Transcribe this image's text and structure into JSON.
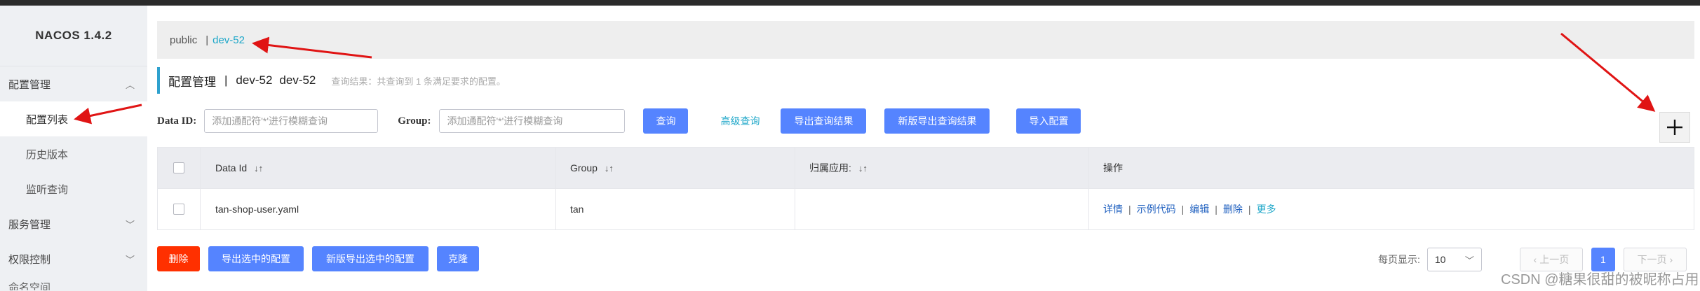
{
  "app": {
    "logo": "NACOS 1.4.2"
  },
  "sidebar": {
    "groups": [
      {
        "label": "配置管理",
        "items": [
          "配置列表",
          "历史版本",
          "监听查询"
        ]
      },
      {
        "label": "服务管理"
      },
      {
        "label": "权限控制"
      },
      {
        "label": "命名空间"
      }
    ]
  },
  "namespace_bar": {
    "public": "public",
    "separator": "|",
    "active": "dev-52"
  },
  "title": {
    "main": "配置管理",
    "separator": "|",
    "ns_name": "dev-52",
    "ns_id": "dev-52",
    "hint": "查询结果：共查询到 1 条满足要求的配置。"
  },
  "search": {
    "data_id_label": "Data ID:",
    "data_id_placeholder": "添加通配符'*'进行模糊查询",
    "group_label": "Group:",
    "group_placeholder": "添加通配符'*'进行模糊查询",
    "query_button": "查询",
    "advanced_link": "高级查询",
    "export_button": "导出查询结果",
    "new_export_button": "新版导出查询结果",
    "import_button": "导入配置"
  },
  "table": {
    "headers": [
      "Data Id",
      "Group",
      "归属应用:",
      "操作"
    ],
    "sort_glyph": "↓↑",
    "rows": [
      {
        "data_id": "tan-shop-user.yaml",
        "group": "tan",
        "app": ""
      }
    ],
    "actions": [
      "详情",
      "示例代码",
      "编辑",
      "删除",
      "更多"
    ],
    "action_separator": "|"
  },
  "bottom_actions": {
    "delete": "删除",
    "export_selected": "导出选中的配置",
    "new_export_selected": "新版导出选中的配置",
    "clone": "克隆"
  },
  "pagination": {
    "page_size_label": "每页显示:",
    "page_size": "10",
    "prev": "上一页",
    "current_page": "1",
    "next": "下一页"
  },
  "watermark": "CSDN @糖果很甜的被昵称占用",
  "colors": {
    "primary": "#5584ff",
    "danger": "#ff3000",
    "link": "#1ea7c9",
    "action_link": "#1e5fbf",
    "annotation_arrow": "#e01414"
  }
}
